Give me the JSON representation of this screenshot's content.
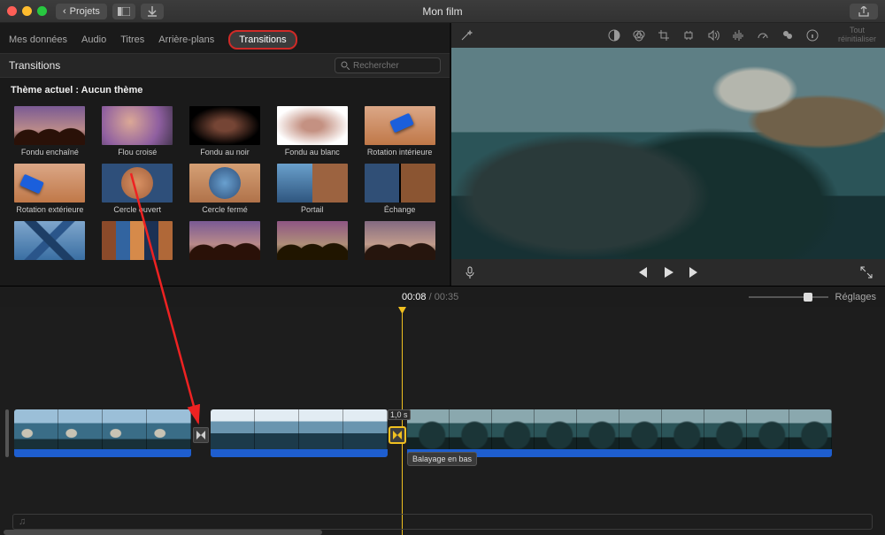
{
  "titlebar": {
    "back_label": "Projets",
    "window_title": "Mon film"
  },
  "tabs": {
    "data": "Mes données",
    "audio": "Audio",
    "titres": "Titres",
    "arriere": "Arrière-plans",
    "transitions": "Transitions"
  },
  "panel": {
    "title": "Transitions",
    "search_placeholder": "Rechercher"
  },
  "theme_label": "Thème actuel : Aucun thème",
  "transitions": {
    "fondu_enchaine": "Fondu enchaîné",
    "flou_croise": "Flou croisé",
    "fondu_noir": "Fondu au noir",
    "fondu_blanc": "Fondu au blanc",
    "rotation_int": "Rotation intérieure",
    "rotation_ext": "Rotation extérieure",
    "cercle_ouvert": "Cercle ouvert",
    "cercle_ferme": "Cercle fermé",
    "portail": "Portail",
    "echange": "Échange"
  },
  "viewer": {
    "reset_line1": "Tout",
    "reset_line2": "réinitialiser"
  },
  "timecode": {
    "current": "00:08",
    "sep": " / ",
    "total": "00:35"
  },
  "settings_label": "Réglages",
  "timeline": {
    "transition_duration": "1,0 s",
    "transition_tooltip": "Balayage en bas"
  }
}
